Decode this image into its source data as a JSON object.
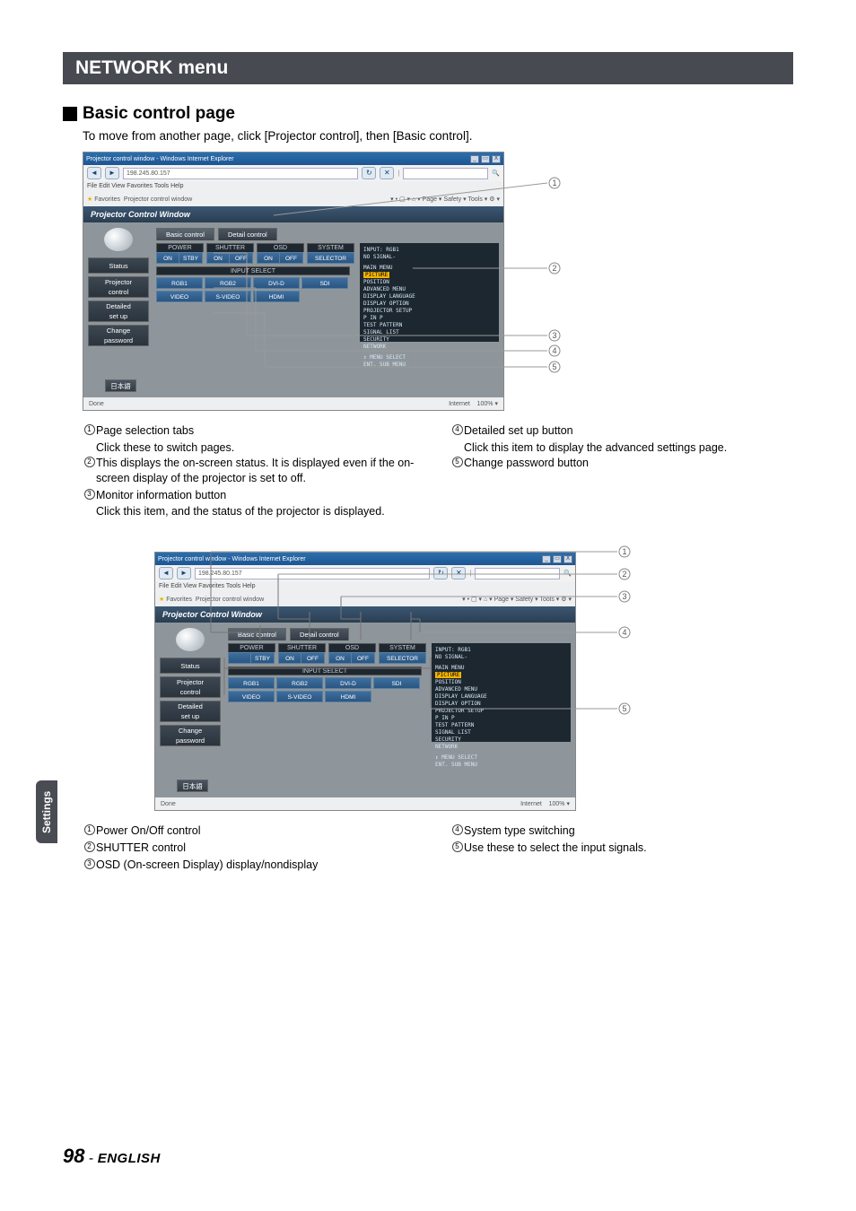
{
  "header": {
    "title": "NETWORK menu"
  },
  "section": {
    "title": "Basic control page",
    "intro": "To move from another page, click [Projector control], then [Basic control]."
  },
  "left_tab": "Settings",
  "footer": {
    "page": "98",
    "sep": " - ",
    "language": "ENGLISH"
  },
  "browser": {
    "title": "Projector control window - Windows Internet Explorer",
    "address": "198.245.80.157",
    "menu": "File   Edit   View   Favorites   Tools   Help",
    "fav_label": "Favorites",
    "fav_item": "Projector control window",
    "tool_right": "▾  •  ▢  ▾  ⌂  ▾  Page ▾  Safety ▾  Tools ▾  ⚙ ▾",
    "app_title": "Projector Control Window",
    "status_left": "Done",
    "status_mid": "Internet",
    "status_right": "100%  ▾",
    "win_close": "X",
    "win_max": "▭",
    "win_min": "_"
  },
  "sidebar": {
    "status": "Status",
    "projector_l1": "Projector",
    "projector_l2": "control",
    "detailed_l1": "Detailed",
    "detailed_l2": "set up",
    "change_l1": "Change",
    "change_l2": "password",
    "lang": "日本語"
  },
  "tabs": {
    "basic": "Basic control",
    "detail": "Detail control"
  },
  "controls": {
    "power": {
      "label": "POWER",
      "on": "ON",
      "off": "STBY"
    },
    "shutter": {
      "label": "SHUTTER",
      "on": "ON",
      "off": "OFF"
    },
    "osd": {
      "label": "OSD",
      "on": "ON",
      "off": "OFF"
    },
    "system": {
      "label": "SYSTEM",
      "btn": "SELECTOR"
    },
    "input_select": {
      "label": "INPUT SELECT",
      "rgb1": "RGB1",
      "rgb2": "RGB2",
      "dvi": "DVI-D",
      "sdi": "SDI",
      "video": "VIDEO",
      "svideo": "S-VIDEO",
      "hdmi": "HDMI"
    }
  },
  "osd_panel": {
    "input": "INPUT: RGB1",
    "nosig": "NO SIGNAL-",
    "main": "MAIN MENU",
    "items": [
      "PICTURE",
      "POSITION",
      "ADVANCED MENU",
      "DISPLAY LANGUAGE",
      "DISPLAY OPTION",
      "PROJECTOR SETUP",
      "P IN P",
      "TEST PATTERN",
      "SIGNAL LIST",
      "SECURITY",
      "NETWORK"
    ],
    "hint1": "↕   MENU SELECT",
    "hint2": "ENT. SUB MENU"
  },
  "fig1_legend_left": {
    "1": {
      "title": "Page selection tabs",
      "desc": "Click these to switch pages."
    },
    "2": {
      "title": "This displays the on-screen status. It is displayed even if the on-screen display of the projector is set to off."
    },
    "3": {
      "title": "Monitor information button",
      "desc": "Click this item, and the status of the projector is displayed."
    }
  },
  "fig1_legend_right": {
    "4": {
      "title": "Detailed set up button",
      "desc": "Click this item to display the advanced settings page."
    },
    "5": {
      "title": "Change password button"
    }
  },
  "fig2_legend_left": {
    "1": "Power On/Off control",
    "2": "SHUTTER control",
    "3": "OSD (On-screen Display) display/nondisplay"
  },
  "fig2_legend_right": {
    "4": "System type switching",
    "5": "Use these to select the input signals."
  }
}
